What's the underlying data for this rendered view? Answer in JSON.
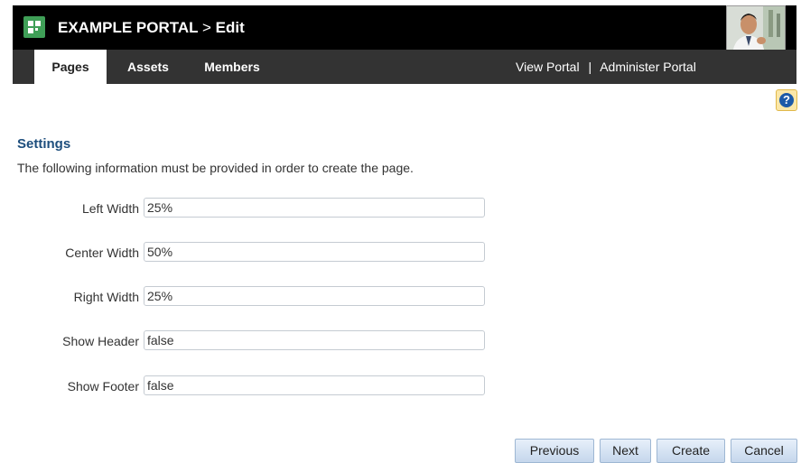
{
  "header": {
    "portal_name": "EXAMPLE PORTAL",
    "separator": ">",
    "mode": "Edit",
    "logo_icon": "portal-grid-icon",
    "brand_color": "#3f9f57"
  },
  "nav": {
    "tabs": [
      {
        "label": "Pages",
        "active": true
      },
      {
        "label": "Assets",
        "active": false
      },
      {
        "label": "Members",
        "active": false
      }
    ],
    "links": {
      "view_portal": "View Portal",
      "divider": "|",
      "administer_portal": "Administer Portal"
    }
  },
  "help": {
    "icon": "help-icon",
    "glyph": "?"
  },
  "settings": {
    "title": "Settings",
    "description": "The following information must be provided in order to create the page.",
    "fields": [
      {
        "label": "Left Width",
        "value": "25%"
      },
      {
        "label": "Center Width",
        "value": "50%"
      },
      {
        "label": "Right Width",
        "value": "25%"
      },
      {
        "label": "Show Header",
        "value": "false"
      },
      {
        "label": "Show Footer",
        "value": "false"
      }
    ]
  },
  "buttons": {
    "previous": "Previous",
    "next": "Next",
    "create": "Create",
    "cancel": "Cancel"
  }
}
